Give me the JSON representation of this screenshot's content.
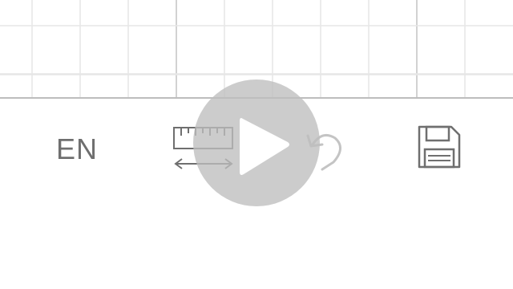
{
  "toolbar": {
    "language_label": "EN",
    "icons": {
      "ruler": "ruler-measure-icon",
      "undo": "undo-icon",
      "save": "save-floppy-icon"
    }
  },
  "overlay": {
    "icon": "play-icon"
  },
  "colors": {
    "grid_line_minor": "#e6e6e6",
    "grid_line_major": "#d2d2d2",
    "divider": "#bdbdbd",
    "icon": "#6f6f6f",
    "icon_disabled": "#c4c4c4",
    "overlay_fill": "#bebebe"
  }
}
